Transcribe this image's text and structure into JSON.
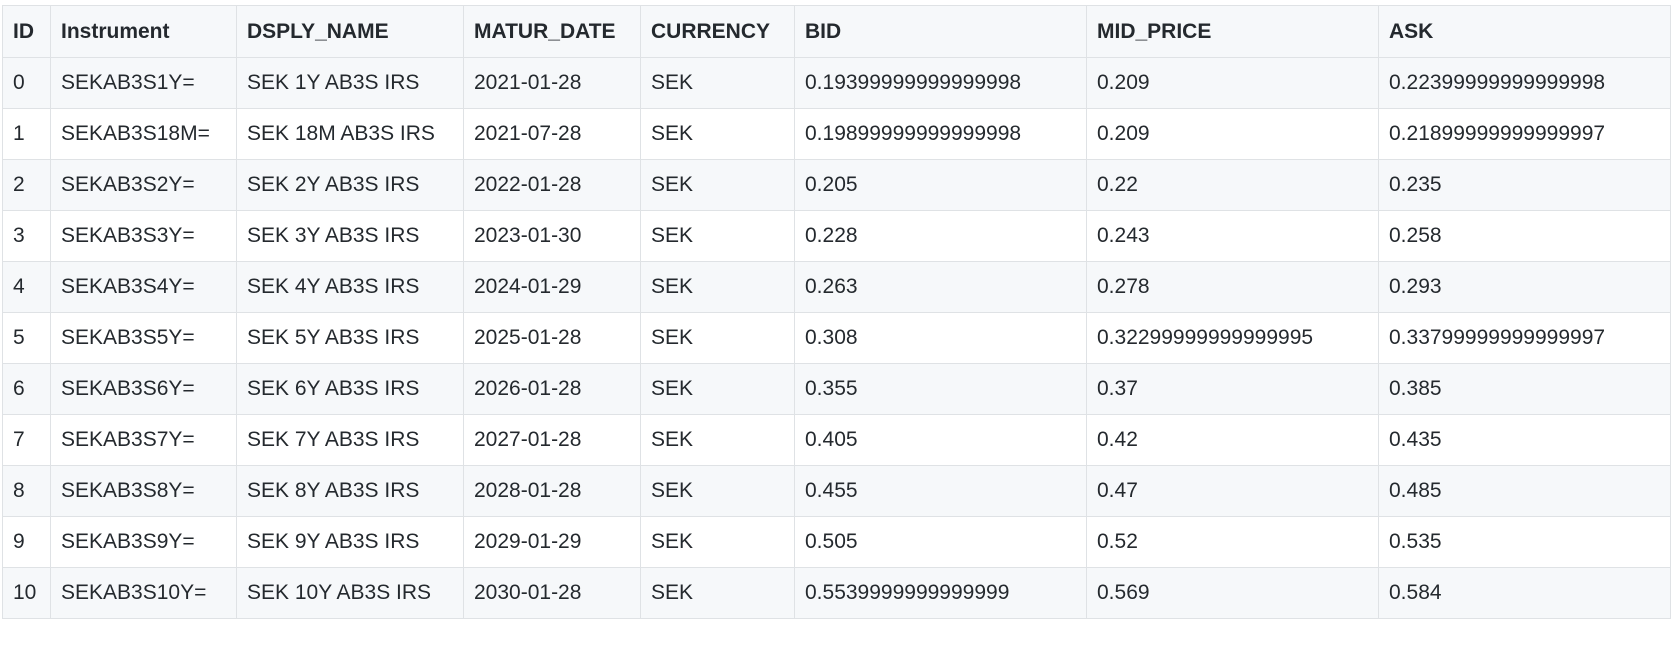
{
  "table": {
    "columns": [
      "ID",
      "Instrument",
      "DSPLY_NAME",
      "MATUR_DATE",
      "CURRENCY",
      "BID",
      "MID_PRICE",
      "ASK"
    ],
    "rows": [
      [
        "0",
        "SEKAB3S1Y=",
        "SEK 1Y AB3S IRS",
        "2021-01-28",
        "SEK",
        "0.19399999999999998",
        "0.209",
        "0.22399999999999998"
      ],
      [
        "1",
        "SEKAB3S18M=",
        "SEK 18M AB3S IRS",
        "2021-07-28",
        "SEK",
        "0.19899999999999998",
        "0.209",
        "0.21899999999999997"
      ],
      [
        "2",
        "SEKAB3S2Y=",
        "SEK 2Y AB3S IRS",
        "2022-01-28",
        "SEK",
        "0.205",
        "0.22",
        "0.235"
      ],
      [
        "3",
        "SEKAB3S3Y=",
        "SEK 3Y AB3S IRS",
        "2023-01-30",
        "SEK",
        "0.228",
        "0.243",
        "0.258"
      ],
      [
        "4",
        "SEKAB3S4Y=",
        "SEK 4Y AB3S IRS",
        "2024-01-29",
        "SEK",
        "0.263",
        "0.278",
        "0.293"
      ],
      [
        "5",
        "SEKAB3S5Y=",
        "SEK 5Y AB3S IRS",
        "2025-01-28",
        "SEK",
        "0.308",
        "0.32299999999999995",
        "0.33799999999999997"
      ],
      [
        "6",
        "SEKAB3S6Y=",
        "SEK 6Y AB3S IRS",
        "2026-01-28",
        "SEK",
        "0.355",
        "0.37",
        "0.385"
      ],
      [
        "7",
        "SEKAB3S7Y=",
        "SEK 7Y AB3S IRS",
        "2027-01-28",
        "SEK",
        "0.405",
        "0.42",
        "0.435"
      ],
      [
        "8",
        "SEKAB3S8Y=",
        "SEK 8Y AB3S IRS",
        "2028-01-28",
        "SEK",
        "0.455",
        "0.47",
        "0.485"
      ],
      [
        "9",
        "SEKAB3S9Y=",
        "SEK 9Y AB3S IRS",
        "2029-01-29",
        "SEK",
        "0.505",
        "0.52",
        "0.535"
      ],
      [
        "10",
        "SEKAB3S10Y=",
        "SEK 10Y AB3S IRS",
        "2030-01-28",
        "SEK",
        "0.5539999999999999",
        "0.569",
        "0.584"
      ]
    ]
  }
}
